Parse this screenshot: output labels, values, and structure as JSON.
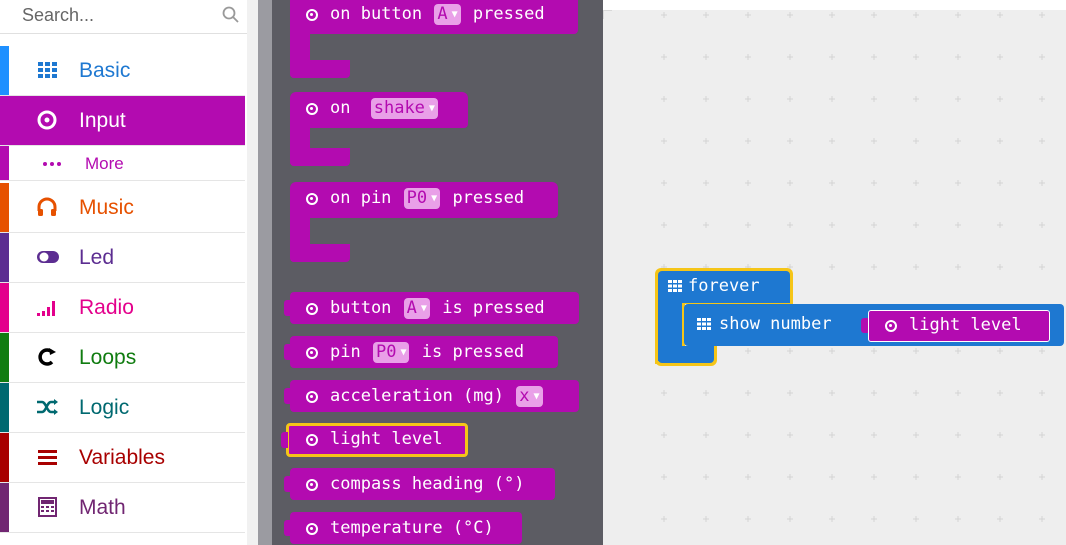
{
  "search": {
    "placeholder": "Search..."
  },
  "categories": [
    {
      "id": "basic",
      "label": "Basic",
      "icon": "grid-icon",
      "color": "#1e90ff"
    },
    {
      "id": "input",
      "label": "Input",
      "icon": "target-icon",
      "color": "#b30bb0",
      "selected": true
    },
    {
      "id": "more",
      "label": "More",
      "icon": "ellipsis-icon",
      "color": "#b30bb0"
    },
    {
      "id": "music",
      "label": "Music",
      "icon": "headphones-icon",
      "color": "#e65100"
    },
    {
      "id": "led",
      "label": "Led",
      "icon": "toggle-icon",
      "color": "#5c2d91"
    },
    {
      "id": "radio",
      "label": "Radio",
      "icon": "signal-bars-icon",
      "color": "#e3008c"
    },
    {
      "id": "loops",
      "label": "Loops",
      "icon": "loop-icon",
      "color": "#107c10"
    },
    {
      "id": "logic",
      "label": "Logic",
      "icon": "shuffle-icon",
      "color": "#006970"
    },
    {
      "id": "variables",
      "label": "Variables",
      "icon": "lines-icon",
      "color": "#a80000"
    },
    {
      "id": "math",
      "label": "Math",
      "icon": "calculator-icon",
      "color": "#712672"
    }
  ],
  "flyout": {
    "blocks": [
      {
        "id": "on-button",
        "text1": "on button",
        "dd": "A",
        "text2": "pressed"
      },
      {
        "id": "on-shake",
        "text1": "on",
        "dd": "shake",
        "text2": ""
      },
      {
        "id": "on-pin",
        "text1": "on pin",
        "dd": "P0",
        "text2": "pressed"
      },
      {
        "id": "button-is-pressed",
        "text1": "button",
        "dd": "A",
        "text2": "is pressed"
      },
      {
        "id": "pin-is-pressed",
        "text1": "pin",
        "dd": "P0",
        "text2": "is pressed"
      },
      {
        "id": "acceleration",
        "text1": "acceleration (mg)",
        "dd": "x",
        "text2": ""
      },
      {
        "id": "light-level",
        "text1": "light level"
      },
      {
        "id": "compass-heading",
        "text1": "compass heading (°)"
      },
      {
        "id": "temperature",
        "text1": "temperature (°C)"
      }
    ]
  },
  "workspace": {
    "forever_label": "forever",
    "show_number_label": "show number",
    "light_level_label": "light level"
  },
  "colors": {
    "input": "#b30bb0",
    "basic": "#1e78d1",
    "highlight": "#f5c518"
  }
}
